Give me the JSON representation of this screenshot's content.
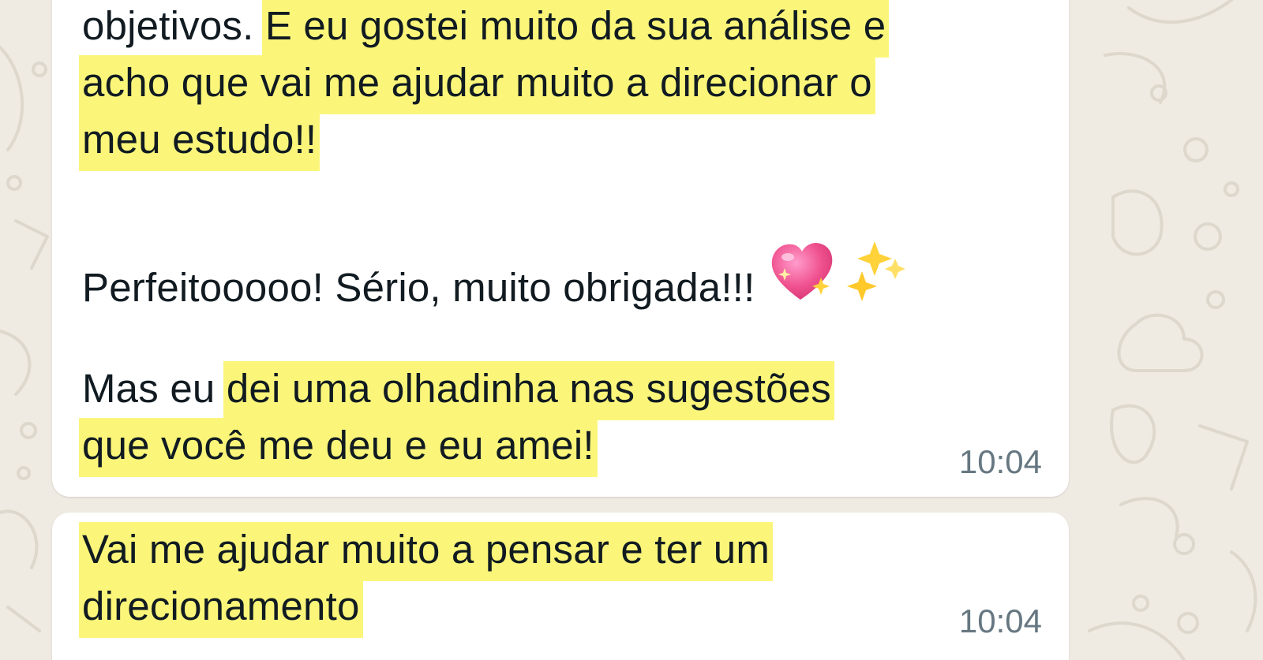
{
  "colors": {
    "wallpaper": "#efeae2",
    "bubble": "#ffffff",
    "highlight": "#fbf67a",
    "text": "#111b21",
    "timestamp": "#667781"
  },
  "messages": [
    {
      "lines": [
        {
          "plain": "objetivos. ",
          "highlighted": "E eu gostei muito da sua análise e"
        },
        {
          "plain": "",
          "highlighted": "acho que vai me ajudar muito a direcionar o"
        },
        {
          "plain": "",
          "highlighted": "meu estudo!!"
        },
        {
          "plain": "Perfeitooooo! Sério, muito obrigada!!!",
          "emoji": [
            "sparkling-heart",
            "sparkles"
          ]
        },
        {
          "plain": "Mas eu ",
          "highlighted": "dei uma olhadinha nas sugestões"
        },
        {
          "plain": "",
          "highlighted": "que você me deu e eu amei!"
        }
      ],
      "time": "10:04"
    },
    {
      "lines": [
        {
          "plain": "",
          "highlighted": "Vai me ajudar muito a pensar e ter um"
        },
        {
          "plain": "",
          "highlighted": "direcionamento"
        }
      ],
      "time": "10:04"
    }
  ]
}
